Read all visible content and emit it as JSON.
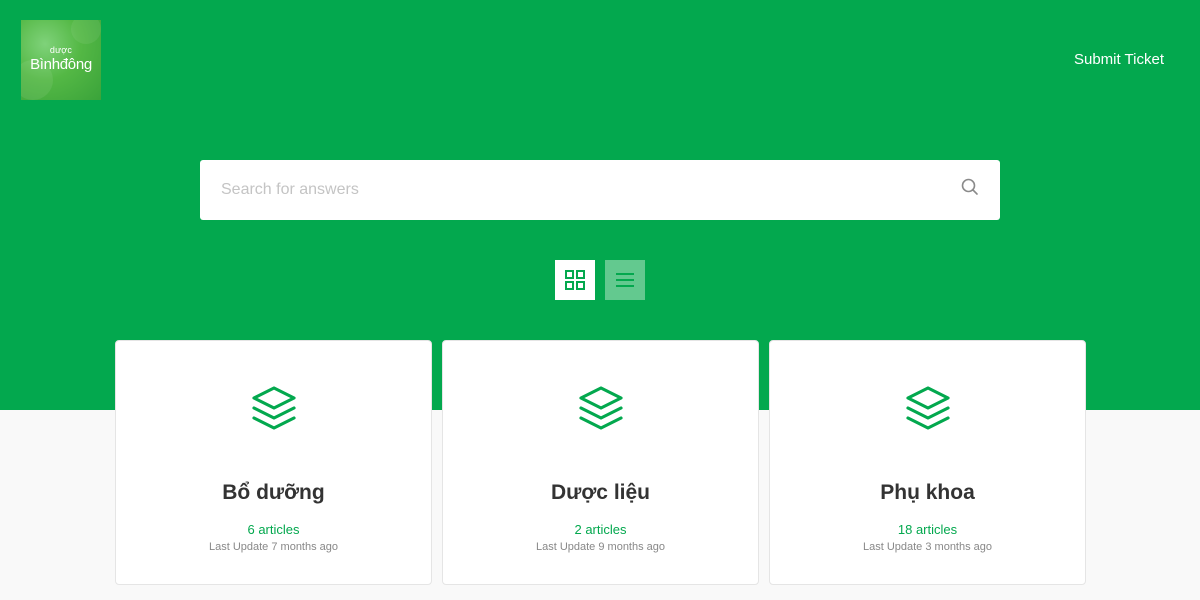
{
  "header": {
    "logo_small": "dược",
    "logo_large": "Bìnhđông",
    "submit_ticket": "Submit Ticket"
  },
  "search": {
    "placeholder": "Search for answers"
  },
  "view_toggle": {
    "active": "grid"
  },
  "colors": {
    "brand_green": "#03a84e",
    "list_toggle": "#63c98f"
  },
  "categories": [
    {
      "title": "Bổ dưỡng",
      "count": "6 articles",
      "updated": "Last Update 7 months ago",
      "icon": "layers-icon"
    },
    {
      "title": "Dược liệu",
      "count": "2 articles",
      "updated": "Last Update 9 months ago",
      "icon": "layers-icon"
    },
    {
      "title": "Phụ khoa",
      "count": "18 articles",
      "updated": "Last Update 3 months ago",
      "icon": "layers-icon"
    }
  ]
}
